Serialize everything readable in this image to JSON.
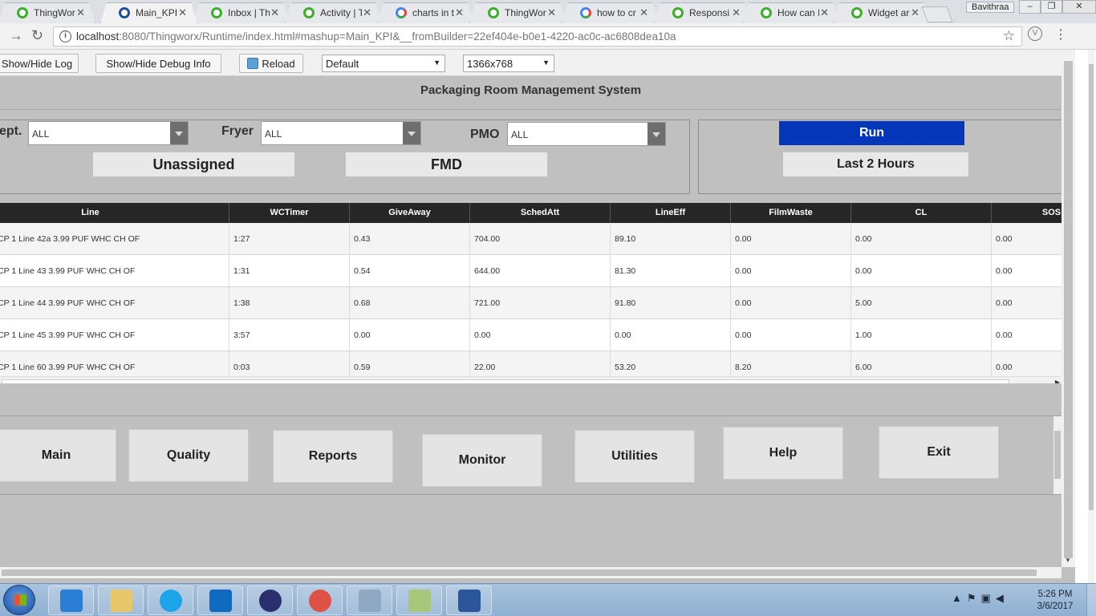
{
  "browser": {
    "tabs": [
      {
        "label": "ThingWorx",
        "favicon": "thingworx-gear-icon"
      },
      {
        "label": "Main_KPI",
        "favicon": "thingworx-mashup-icon",
        "active": true
      },
      {
        "label": "Inbox | Th",
        "favicon": "thingworx-gear-icon"
      },
      {
        "label": "Activity | T",
        "favicon": "thingworx-gear-icon"
      },
      {
        "label": "charts in t",
        "favicon": "google-icon"
      },
      {
        "label": "ThingWor",
        "favicon": "thingworx-gear-icon"
      },
      {
        "label": "how to cr",
        "favicon": "google-icon"
      },
      {
        "label": "Responsi",
        "favicon": "thingworx-gear-icon"
      },
      {
        "label": "How can I",
        "favicon": "thingworx-gear-icon"
      },
      {
        "label": "Widget ar",
        "favicon": "thingworx-gear-icon"
      }
    ],
    "profile_name": "Bavithraa",
    "url_host": "localhost",
    "url_rest": ":8080/Thingworx/Runtime/index.html#mashup=Main_KPI&__fromBuilder=22ef404e-b0e1-4220-ac0c-ac6808dea10a"
  },
  "devbar": {
    "log_label": "Show/Hide Log",
    "debug_label": "Show/Hide Debug Info",
    "reload_label": "Reload",
    "theme_value": "Default",
    "resolution_value": "1366x768"
  },
  "app": {
    "title": "Packaging Room Management System",
    "filters": {
      "dept_label": "ept.",
      "dept_value": "ALL",
      "fryer_label": "Fryer",
      "fryer_value": "ALL",
      "pmo_label": "PMO",
      "pmo_value": "ALL"
    },
    "unassigned_label": "Unassigned",
    "fmd_label": "FMD",
    "run_label": "Run",
    "timespan_label": "Last 2 Hours",
    "accent_color": "#0336b8"
  },
  "grid": {
    "columns": [
      "Line",
      "WCTimer",
      "GiveAway",
      "SchedAtt",
      "LineEff",
      "FilmWaste",
      "CL",
      "SOS"
    ],
    "rows": [
      [
        "CP 1 Line 42a 3.99 PUF WHC CH OF",
        "1:27",
        "0.43",
        "704.00",
        "89.10",
        "0.00",
        "0.00",
        "0.00"
      ],
      [
        "CP 1 Line 43 3.99 PUF WHC CH OF",
        "1:31",
        "0.54",
        "644.00",
        "81.30",
        "0.00",
        "0.00",
        "0.00"
      ],
      [
        "CP 1 Line 44 3.99 PUF WHC CH OF",
        "1:38",
        "0.68",
        "721.00",
        "91.80",
        "0.00",
        "5.00",
        "0.00"
      ],
      [
        "CP 1 Line 45 3.99 PUF WHC CH OF",
        "3:57",
        "0.00",
        "0.00",
        "0.00",
        "0.00",
        "1.00",
        "0.00"
      ],
      [
        "CP 1 Line 60 3.99 PUF WHC CH OF",
        "0:03",
        "0.59",
        "22.00",
        "53.20",
        "8.20",
        "6.00",
        "0.00"
      ]
    ]
  },
  "nav": [
    "Main",
    "Quality",
    "Reports",
    "Monitor",
    "Utilities",
    "Help",
    "Exit"
  ],
  "taskbar": {
    "apps": [
      "internet-explorer-icon",
      "file-explorer-icon",
      "skype-icon",
      "outlook-icon",
      "eclipse-icon",
      "chrome-icon",
      "tools-icon",
      "notepad-plus-plus-icon",
      "word-icon"
    ],
    "time": "5:26 PM",
    "date": "3/6/2017"
  }
}
